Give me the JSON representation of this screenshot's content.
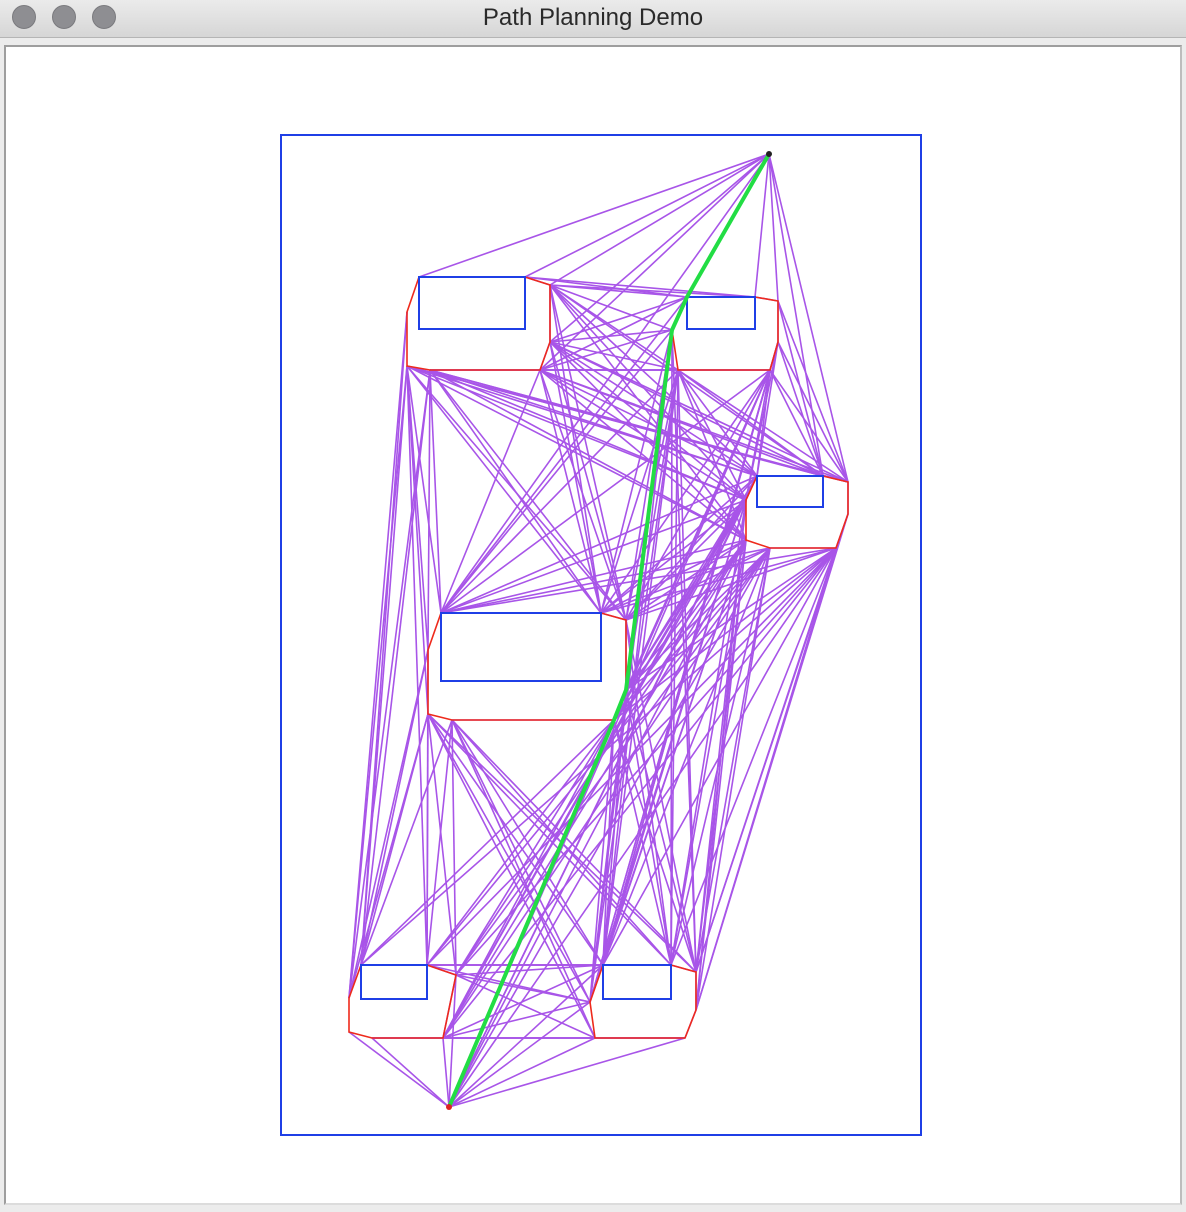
{
  "window": {
    "title": "Path Planning Demo"
  },
  "colors": {
    "boundary": "#1f3fe6",
    "obstacle": "#1f3fe6",
    "expanded": "#ee2a1c",
    "visibility": "#a855e8",
    "path": "#22dd44"
  },
  "icons": [
    "close-button-icon",
    "minimize-button-icon",
    "zoom-button-icon"
  ]
}
